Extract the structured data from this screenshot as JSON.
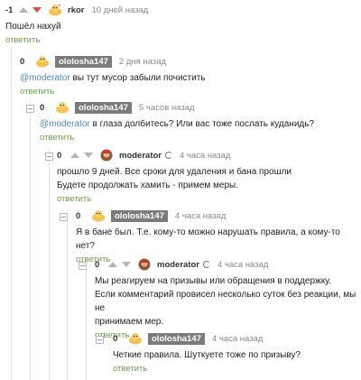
{
  "reply_label": "ответить",
  "comments": [
    {
      "rating": "-1",
      "author": "rkor",
      "time": "10 дней назад",
      "text": "Пошёл нахуй"
    },
    {
      "rating": "0",
      "author": "ololosha147",
      "time": "2 дня назад",
      "mention": "@moderator",
      "text": " вы тут мусор забыли почистить"
    },
    {
      "rating": "0",
      "author": "ololosha147",
      "time": "5 часов назад",
      "mention": "@moderator",
      "text": " в глаза долбитесь? Или вас тоже послать куданидь?"
    },
    {
      "rating": "0",
      "author": "moderator",
      "time": "4 часа назад",
      "lines": [
        "прошло 9 дней. Все сроки для удаления и бана прошли",
        "Будете продолжать хамить - примем меры."
      ]
    },
    {
      "rating": "0",
      "author": "ololosha147",
      "time": "4 часа назад",
      "text": "Я в бане был. Т.е. кому-то можно нарушать правила, а кому-то нет?"
    },
    {
      "rating": "0",
      "author": "moderator",
      "time": "4 часа назад",
      "lines": [
        "Мы реагируем на призывы или обращения в поддержку.",
        "Если комментарий провисел несколько суток без реакции, мы не",
        "принимаем мер."
      ]
    },
    {
      "rating": "0",
      "author": "ololosha147",
      "time": "4 часа назад",
      "text": "Четкие правила. Шуткуете тоже по призыву?"
    }
  ]
}
